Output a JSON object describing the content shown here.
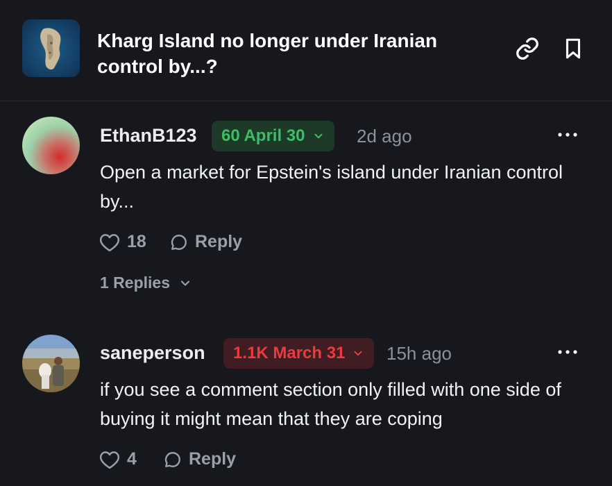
{
  "header": {
    "title": "Kharg Island no longer under Iranian control by...?",
    "thumbnail_icon": "island-satellite-thumbnail",
    "link_icon": "link-icon",
    "bookmark_icon": "bookmark-icon"
  },
  "comments": [
    {
      "username": "EthanB123",
      "position_badge": "60 April 30",
      "badge_color": "#3fbd66",
      "time": "2d ago",
      "text": "Open a market for Epstein's island under Iranian control by...",
      "likes": "18",
      "reply_label": "Reply",
      "replies_label": "1 Replies"
    },
    {
      "username": "saneperson",
      "position_badge": "1.1K March 31",
      "badge_color": "#ea3b40",
      "time": "15h ago",
      "text": "if you see a comment section only filled with one side of buying it might mean that they are coping",
      "likes": "4",
      "reply_label": "Reply"
    }
  ]
}
